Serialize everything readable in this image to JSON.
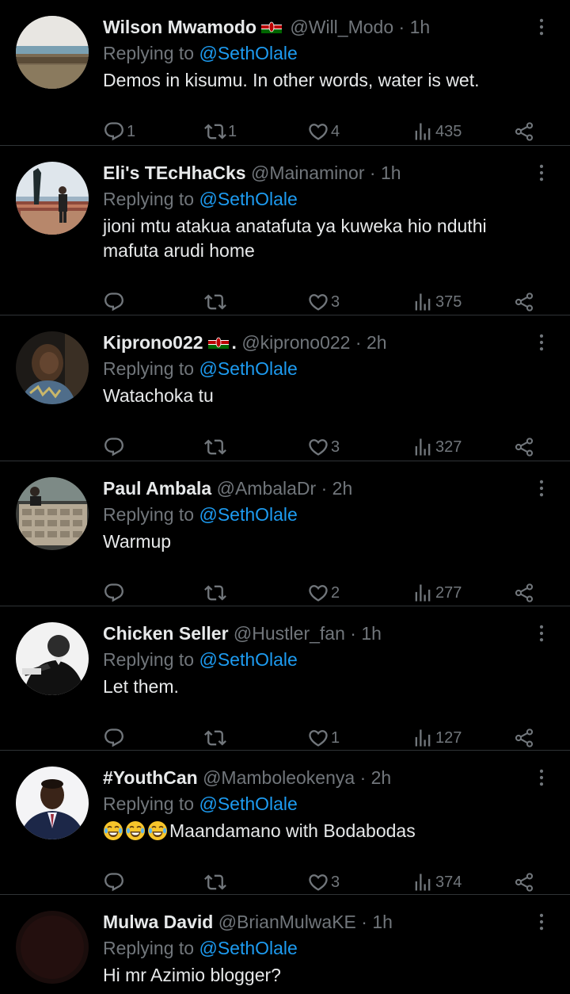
{
  "colors": {
    "background": "#000000",
    "text": "#e7e9ea",
    "muted": "#71767b",
    "mention": "#1d9bf0",
    "divider": "#2f3336"
  },
  "tweets": [
    {
      "name": "Wilson Mwamodo",
      "flag": "kenya-flag",
      "handle": "@Will_Modo",
      "dot": "·",
      "time": "1h",
      "replying_prefix": "Replying to ",
      "mention": "@SethOlale",
      "text": "Demos in kisumu. In other words, water is wet.",
      "replies": "1",
      "retweets": "1",
      "likes": "4",
      "views": "435"
    },
    {
      "name": "Eli's TEcHhaCks",
      "handle": "@Mainaminor",
      "dot": "·",
      "time": "1h",
      "replying_prefix": "Replying to ",
      "mention": "@SethOlale",
      "text": "jioni mtu atakua anatafuta ya kuweka hio nduthi mafuta arudi home",
      "replies": "",
      "retweets": "",
      "likes": "3",
      "views": "375"
    },
    {
      "name": "Kiprono022",
      "flag": "kenya-flag",
      "name_suffix": ".",
      "handle": "@kiprono022",
      "dot": "·",
      "time": "2h",
      "replying_prefix": "Replying to ",
      "mention": "@SethOlale",
      "text": "Watachoka tu",
      "replies": "",
      "retweets": "",
      "likes": "3",
      "views": "327"
    },
    {
      "name": "Paul Ambala",
      "handle": "@AmbalaDr",
      "dot": "·",
      "time": "2h",
      "replying_prefix": "Replying to ",
      "mention": "@SethOlale",
      "text": "Warmup",
      "replies": "",
      "retweets": "",
      "likes": "2",
      "views": "277"
    },
    {
      "name": "Chicken Seller",
      "handle": "@Hustler_fan",
      "dot": "·",
      "time": "1h",
      "replying_prefix": "Replying to ",
      "mention": "@SethOlale",
      "text": "Let them.",
      "replies": "",
      "retweets": "",
      "likes": "1",
      "views": "127"
    },
    {
      "name": "#YouthCan",
      "handle": "@Mamboleokenya",
      "dot": "·",
      "time": "2h",
      "replying_prefix": "Replying to ",
      "mention": "@SethOlale",
      "text": "Maandamano with Bodabodas",
      "text_emoji": "face-with-tears-of-joy-icon x3",
      "replies": "",
      "retweets": "",
      "likes": "3",
      "views": "374"
    },
    {
      "name": "Mulwa David",
      "handle": "@BrianMulwaKE",
      "dot": "·",
      "time": "1h",
      "replying_prefix": "Replying to ",
      "mention": "@SethOlale",
      "text": "Hi mr Azimio blogger?"
    }
  ]
}
